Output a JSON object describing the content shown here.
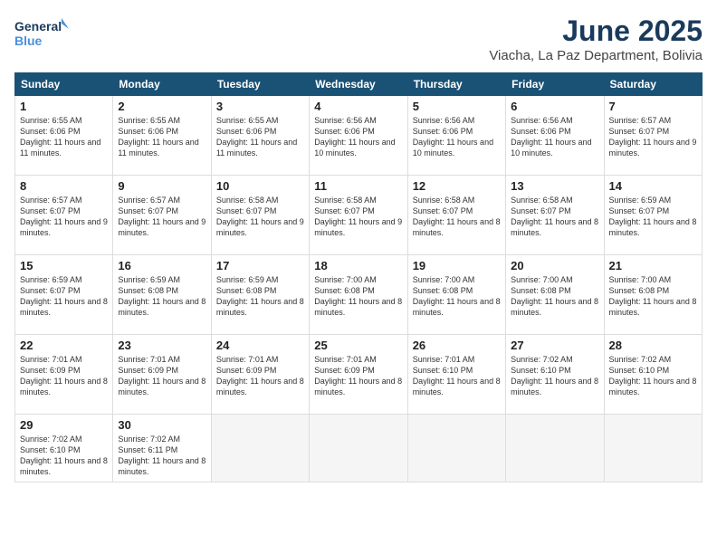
{
  "logo": {
    "line1": "General",
    "line2": "Blue"
  },
  "title": "June 2025",
  "location": "Viacha, La Paz Department, Bolivia",
  "weekdays": [
    "Sunday",
    "Monday",
    "Tuesday",
    "Wednesday",
    "Thursday",
    "Friday",
    "Saturday"
  ],
  "weeks": [
    [
      {
        "day": "1",
        "info": "Sunrise: 6:55 AM\nSunset: 6:06 PM\nDaylight: 11 hours\nand 11 minutes."
      },
      {
        "day": "2",
        "info": "Sunrise: 6:55 AM\nSunset: 6:06 PM\nDaylight: 11 hours\nand 11 minutes."
      },
      {
        "day": "3",
        "info": "Sunrise: 6:55 AM\nSunset: 6:06 PM\nDaylight: 11 hours\nand 11 minutes."
      },
      {
        "day": "4",
        "info": "Sunrise: 6:56 AM\nSunset: 6:06 PM\nDaylight: 11 hours\nand 10 minutes."
      },
      {
        "day": "5",
        "info": "Sunrise: 6:56 AM\nSunset: 6:06 PM\nDaylight: 11 hours\nand 10 minutes."
      },
      {
        "day": "6",
        "info": "Sunrise: 6:56 AM\nSunset: 6:06 PM\nDaylight: 11 hours\nand 10 minutes."
      },
      {
        "day": "7",
        "info": "Sunrise: 6:57 AM\nSunset: 6:07 PM\nDaylight: 11 hours\nand 9 minutes."
      }
    ],
    [
      {
        "day": "8",
        "info": "Sunrise: 6:57 AM\nSunset: 6:07 PM\nDaylight: 11 hours\nand 9 minutes."
      },
      {
        "day": "9",
        "info": "Sunrise: 6:57 AM\nSunset: 6:07 PM\nDaylight: 11 hours\nand 9 minutes."
      },
      {
        "day": "10",
        "info": "Sunrise: 6:58 AM\nSunset: 6:07 PM\nDaylight: 11 hours\nand 9 minutes."
      },
      {
        "day": "11",
        "info": "Sunrise: 6:58 AM\nSunset: 6:07 PM\nDaylight: 11 hours\nand 9 minutes."
      },
      {
        "day": "12",
        "info": "Sunrise: 6:58 AM\nSunset: 6:07 PM\nDaylight: 11 hours\nand 8 minutes."
      },
      {
        "day": "13",
        "info": "Sunrise: 6:58 AM\nSunset: 6:07 PM\nDaylight: 11 hours\nand 8 minutes."
      },
      {
        "day": "14",
        "info": "Sunrise: 6:59 AM\nSunset: 6:07 PM\nDaylight: 11 hours\nand 8 minutes."
      }
    ],
    [
      {
        "day": "15",
        "info": "Sunrise: 6:59 AM\nSunset: 6:07 PM\nDaylight: 11 hours\nand 8 minutes."
      },
      {
        "day": "16",
        "info": "Sunrise: 6:59 AM\nSunset: 6:08 PM\nDaylight: 11 hours\nand 8 minutes."
      },
      {
        "day": "17",
        "info": "Sunrise: 6:59 AM\nSunset: 6:08 PM\nDaylight: 11 hours\nand 8 minutes."
      },
      {
        "day": "18",
        "info": "Sunrise: 7:00 AM\nSunset: 6:08 PM\nDaylight: 11 hours\nand 8 minutes."
      },
      {
        "day": "19",
        "info": "Sunrise: 7:00 AM\nSunset: 6:08 PM\nDaylight: 11 hours\nand 8 minutes."
      },
      {
        "day": "20",
        "info": "Sunrise: 7:00 AM\nSunset: 6:08 PM\nDaylight: 11 hours\nand 8 minutes."
      },
      {
        "day": "21",
        "info": "Sunrise: 7:00 AM\nSunset: 6:08 PM\nDaylight: 11 hours\nand 8 minutes."
      }
    ],
    [
      {
        "day": "22",
        "info": "Sunrise: 7:01 AM\nSunset: 6:09 PM\nDaylight: 11 hours\nand 8 minutes."
      },
      {
        "day": "23",
        "info": "Sunrise: 7:01 AM\nSunset: 6:09 PM\nDaylight: 11 hours\nand 8 minutes."
      },
      {
        "day": "24",
        "info": "Sunrise: 7:01 AM\nSunset: 6:09 PM\nDaylight: 11 hours\nand 8 minutes."
      },
      {
        "day": "25",
        "info": "Sunrise: 7:01 AM\nSunset: 6:09 PM\nDaylight: 11 hours\nand 8 minutes."
      },
      {
        "day": "26",
        "info": "Sunrise: 7:01 AM\nSunset: 6:10 PM\nDaylight: 11 hours\nand 8 minutes."
      },
      {
        "day": "27",
        "info": "Sunrise: 7:02 AM\nSunset: 6:10 PM\nDaylight: 11 hours\nand 8 minutes."
      },
      {
        "day": "28",
        "info": "Sunrise: 7:02 AM\nSunset: 6:10 PM\nDaylight: 11 hours\nand 8 minutes."
      }
    ],
    [
      {
        "day": "29",
        "info": "Sunrise: 7:02 AM\nSunset: 6:10 PM\nDaylight: 11 hours\nand 8 minutes."
      },
      {
        "day": "30",
        "info": "Sunrise: 7:02 AM\nSunset: 6:11 PM\nDaylight: 11 hours\nand 8 minutes."
      },
      {
        "day": "",
        "info": ""
      },
      {
        "day": "",
        "info": ""
      },
      {
        "day": "",
        "info": ""
      },
      {
        "day": "",
        "info": ""
      },
      {
        "day": "",
        "info": ""
      }
    ]
  ]
}
